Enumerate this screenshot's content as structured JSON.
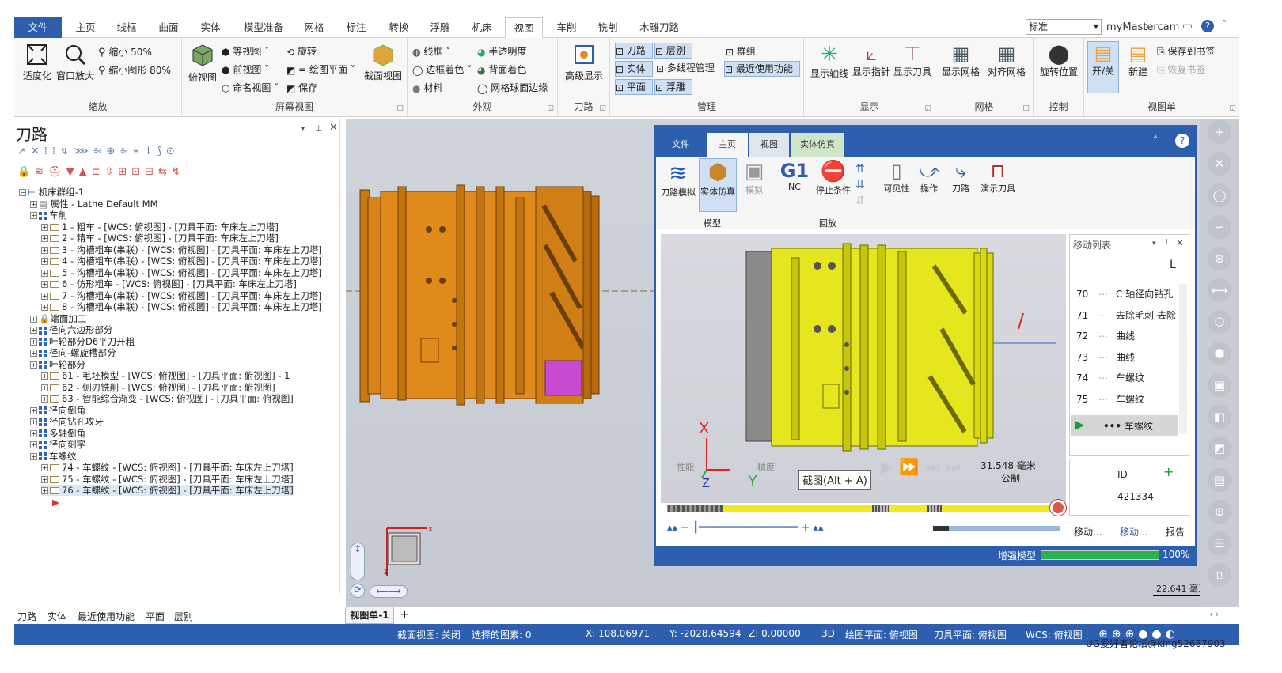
{
  "menu": {
    "tabs": [
      "文件",
      "主页",
      "线框",
      "曲面",
      "实体",
      "模型准备",
      "网格",
      "标注",
      "转换",
      "浮雕",
      "机床",
      "视图",
      "车削",
      "铣削",
      "木雕刀路"
    ],
    "active": "视图",
    "style_value": "标准",
    "account": "myMastercam"
  },
  "ribbon": {
    "zoom": {
      "label": "缩放",
      "fit": "适度化",
      "window": "窗口放大",
      "shrink50": "缩小 50%",
      "shrink80": "缩小图形 80%"
    },
    "screen": {
      "label": "屏幕视图",
      "top": "俯视图",
      "iso": "等视图",
      "front": "前视图",
      "named": "命名视图",
      "rotate": "旋转",
      "eq_plane": "= 绘图平面",
      "save": "保存",
      "section": "截面视图"
    },
    "appearance": {
      "label": "外观",
      "wire": "线框",
      "edge": "边框着色",
      "material": "材料",
      "translucent": "半透明度",
      "back": "背面着色",
      "mesh_edges": "网格球面边缘"
    },
    "toolpath": {
      "label": "刀路",
      "advanced": "高级显示"
    },
    "manage": {
      "label": "管理",
      "toolpath": "刀路",
      "solid": "实体",
      "plane": "平面",
      "layer": "层别",
      "multithread": "多线程管理",
      "relief": "浮雕",
      "group": "群组",
      "recent": "最近使用功能"
    },
    "display": {
      "label": "显示",
      "axis": "显示轴线",
      "gnomon": "显示指针",
      "tool": "显示刀具"
    },
    "grid": {
      "label": "网格",
      "show": "显示网格",
      "snap": "对齐网格"
    },
    "control": {
      "label": "控制",
      "rotpos": "旋转位置"
    },
    "viewsheet": {
      "label": "视图单",
      "onoff": "开/关",
      "new": "新建",
      "save_bm": "保存到书签",
      "restore_bm": "恢复书签"
    }
  },
  "toolpaths": {
    "title": "刀路",
    "tree": [
      {
        "t": "机床群组-1",
        "lvl": 0,
        "kind": "root"
      },
      {
        "t": "属性 - Lathe Default MM",
        "lvl": 1,
        "kind": "prop"
      },
      {
        "t": "车削",
        "lvl": 1,
        "kind": "grp"
      },
      {
        "t": "1 - 粗车 - [WCS: 俯视图] - [刀具平面: 车床左上刀塔]",
        "lvl": 2,
        "kind": "op"
      },
      {
        "t": "2 - 精车 - [WCS: 俯视图] - [刀具平面: 车床左上刀塔]",
        "lvl": 2,
        "kind": "op"
      },
      {
        "t": "3 - 沟槽粗车(串联) - [WCS: 俯视图] - [刀具平面: 车床左上刀塔]",
        "lvl": 2,
        "kind": "op"
      },
      {
        "t": "4 - 沟槽粗车(串联) - [WCS: 俯视图] - [刀具平面: 车床左上刀塔]",
        "lvl": 2,
        "kind": "op"
      },
      {
        "t": "5 - 沟槽粗车(串联) - [WCS: 俯视图] - [刀具平面: 车床左上刀塔]",
        "lvl": 2,
        "kind": "op"
      },
      {
        "t": "6 - 仿形粗车 - [WCS: 俯视图] - [刀具平面: 车床左上刀塔]",
        "lvl": 2,
        "kind": "op"
      },
      {
        "t": "7 - 沟槽粗车(串联) - [WCS: 俯视图] - [刀具平面: 车床左上刀塔]",
        "lvl": 2,
        "kind": "op"
      },
      {
        "t": "8 - 沟槽粗车(串联) - [WCS: 俯视图] - [刀具平面: 车床左上刀塔]",
        "lvl": 2,
        "kind": "op"
      },
      {
        "t": "端面加工",
        "lvl": 1,
        "kind": "lock"
      },
      {
        "t": "径向六边形部分",
        "lvl": 1,
        "kind": "grp"
      },
      {
        "t": "叶轮部分D6平刀开粗",
        "lvl": 1,
        "kind": "grp"
      },
      {
        "t": "径向-螺旋槽部分",
        "lvl": 1,
        "kind": "grp"
      },
      {
        "t": "叶轮部分",
        "lvl": 1,
        "kind": "grp"
      },
      {
        "t": "61 - 毛坯模型 - [WCS: 俯视图] - [刀具平面: 俯视图] - 1",
        "lvl": 2,
        "kind": "op"
      },
      {
        "t": "62 - 侧刃铣削 - [WCS: 俯视图] - [刀具平面: 俯视图]",
        "lvl": 2,
        "kind": "op"
      },
      {
        "t": "63 - 智能综合渐变 - [WCS: 俯视图] - [刀具平面: 俯视图]",
        "lvl": 2,
        "kind": "op"
      },
      {
        "t": "径向倒角",
        "lvl": 1,
        "kind": "grp"
      },
      {
        "t": "径向钻孔攻牙",
        "lvl": 1,
        "kind": "grp"
      },
      {
        "t": "多轴倒角",
        "lvl": 1,
        "kind": "grp"
      },
      {
        "t": "径向刻字",
        "lvl": 1,
        "kind": "grp"
      },
      {
        "t": "车螺纹",
        "lvl": 1,
        "kind": "grp"
      },
      {
        "t": "74 - 车螺纹 - [WCS: 俯视图] - [刀具平面: 车床左上刀塔]",
        "lvl": 2,
        "kind": "op"
      },
      {
        "t": "75 - 车螺纹 - [WCS: 俯视图] - [刀具平面: 车床左上刀塔]",
        "lvl": 2,
        "kind": "op"
      },
      {
        "t": "76 - 车螺纹 - [WCS: 俯视图] - [刀具平面: 车床左上刀塔]",
        "lvl": 2,
        "kind": "op-sel"
      }
    ],
    "bottom_tabs": [
      "刀路",
      "实体",
      "最近使用功能",
      "平面",
      "层别"
    ]
  },
  "viewsheet_tab": "视图单-1",
  "status": {
    "section": "截面视图: 关闭",
    "selected": "选择的图素: 0",
    "x": "X:  108.06971",
    "y": "Y:  -2028.64594",
    "z": "Z:  0.00000",
    "mode": "3D",
    "cplane": "绘图平面: 俯视图",
    "tplane": "刀具平面: 俯视图",
    "wcs": "WCS: 俯视图"
  },
  "scale": "22.641 毫米",
  "watermark": "UG爱好者论坛@king52687903",
  "sim": {
    "tabs": [
      "文件",
      "主页",
      "视图",
      "实体仿真"
    ],
    "model": "模型",
    "playback": "回放",
    "btn_backplot": "刀路模拟",
    "btn_verify": "实体仿真",
    "btn_sim": "模拟",
    "btn_nc": "NC",
    "btn_stop": "停止条件",
    "btn_vis": "可见性",
    "btn_op": "操作",
    "btn_tp": "刀路",
    "btn_demo": "演示刀具",
    "g1": "G1",
    "movelist_title": "移动列表",
    "moves": [
      {
        "n": "70",
        "t": "C 轴径向钻孔"
      },
      {
        "n": "71",
        "t": "去除毛刺 去除"
      },
      {
        "n": "72",
        "t": "曲线"
      },
      {
        "n": "73",
        "t": "曲线"
      },
      {
        "n": "74",
        "t": "车螺纹"
      },
      {
        "n": "75",
        "t": "车螺纹"
      }
    ],
    "current": "车螺纹",
    "col_l": "L",
    "id_label": "ID",
    "id_value": "421334",
    "perf": "性能",
    "precision": "精度",
    "tooltip": "截图(Alt + A)",
    "dist": "31.548 毫米",
    "unit": "公制",
    "btab1": "移动...",
    "btab2": "移动...",
    "btab3": "报告",
    "status_text": "增强模型",
    "progress": "100%",
    "progress_value": 100
  }
}
